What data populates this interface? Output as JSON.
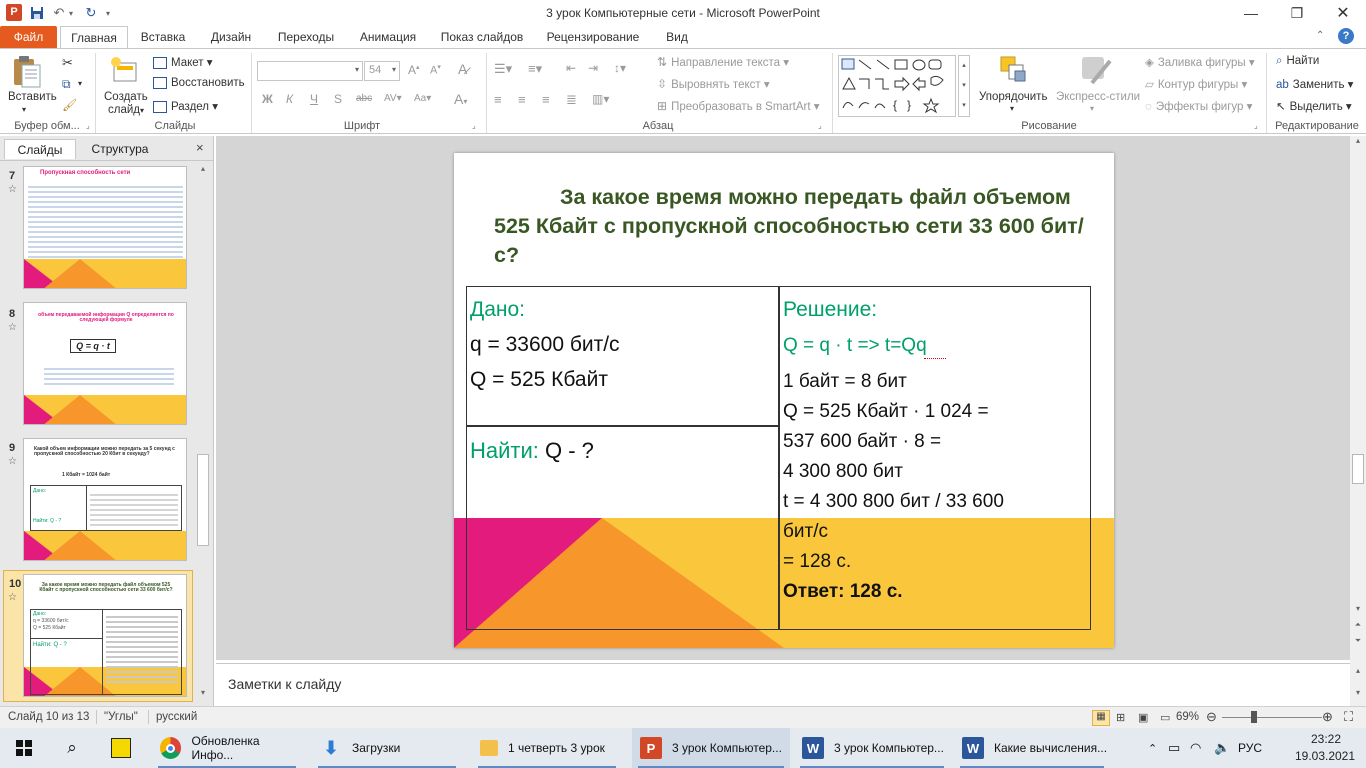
{
  "window": {
    "title": "3 урок Компьютерные сети - Microsoft PowerPoint",
    "app_icon_letter": "P"
  },
  "tabs": [
    "Файл",
    "Главная",
    "Вставка",
    "Дизайн",
    "Переходы",
    "Анимация",
    "Показ слайдов",
    "Рецензирование",
    "Вид"
  ],
  "ribbon": {
    "clipboard": {
      "paste": "Вставить",
      "label": "Буфер обм..."
    },
    "slides": {
      "create_line1": "Создать",
      "create_line2": "слайд",
      "layout": "Макет",
      "restore": "Восстановить",
      "section": "Раздел",
      "label": "Слайды"
    },
    "font": {
      "size": "54",
      "label": "Шрифт"
    },
    "paragraph": {
      "text_direction": "Направление текста",
      "align_text": "Выровнять текст",
      "smartart": "Преобразовать в SmartArt",
      "label": "Абзац"
    },
    "drawing": {
      "arrange": "Упорядочить",
      "quick_styles": "Экспресс-стили",
      "fill": "Заливка фигуры",
      "outline": "Контур фигуры",
      "effects": "Эффекты фигур",
      "label": "Рисование"
    },
    "editing": {
      "find": "Найти",
      "replace": "Заменить",
      "select": "Выделить",
      "label": "Редактирование"
    }
  },
  "panel": {
    "tab_slides": "Слайды",
    "tab_outline": "Структура",
    "close": "×"
  },
  "thumbnails": [
    {
      "num": "7",
      "title": "Пропускная способность сети"
    },
    {
      "num": "8",
      "title": "объем передаваемой информации Q определяется по следующей формуле",
      "formula": "Q = q · t"
    },
    {
      "num": "9",
      "title": "Какой объем информации можно передать за 5 секунд с пропускной способностью 20 Кбит в секунду?",
      "sub": "1 Кбайт = 1024 байт",
      "given": "Дано:",
      "find": "Найти: Q - ?"
    },
    {
      "num": "10",
      "title": "За какое время можно передать файл объемом 525 Кбайт с пропускной способностью сети 33 600 бит/с?",
      "given": "Дано:",
      "find": "Найти: Q - ?"
    }
  ],
  "slide": {
    "title": "За какое время можно передать файл объемом 525 Кбайт с пропускной способностью сети 33 600 бит/с?",
    "given_label": "Дано:",
    "given_lines": [
      "q = 33600 бит/с",
      "Q = 525 Кбайт"
    ],
    "find_label": "Найти:",
    "find_value": " Q - ?",
    "solution_label": "Решение:",
    "formula": "Q = q · t =>  t=Qq",
    "solution_lines": [
      "1 байт = 8 бит",
      "Q = 525 Кбайт · 1 024 =",
      "537 600 байт · 8 =",
      "4 300 800 бит",
      "t = 4 300 800 бит / 33 600",
      "бит/с",
      "= 128 с."
    ],
    "answer": "Ответ: 128 с.",
    "colors": {
      "title": "#385723",
      "green": "#00a06a",
      "yellow": "#f9c63c",
      "orange": "#f7962b",
      "magenta": "#e21b7d"
    }
  },
  "notes_placeholder": "Заметки к слайду",
  "status": {
    "slide_counter": "Слайд 10 из 13",
    "theme": "\"Углы\"",
    "language": "русский",
    "zoom": "69%"
  },
  "taskbar": {
    "items": [
      {
        "label": "Обновленка Инфо...",
        "icon": "chrome-icon"
      },
      {
        "label": "Загрузки",
        "icon": "download-icon"
      },
      {
        "label": "1 четверть 3 урок",
        "icon": "folder-icon"
      },
      {
        "label": "3 урок Компьютер...",
        "icon": "powerpoint-icon"
      },
      {
        "label": "3 урок Компьютер...",
        "icon": "word-icon"
      },
      {
        "label": "Какие вычисления...",
        "icon": "word-icon"
      }
    ],
    "lang": "РУС",
    "time": "23:22",
    "date": "19.03.2021"
  }
}
